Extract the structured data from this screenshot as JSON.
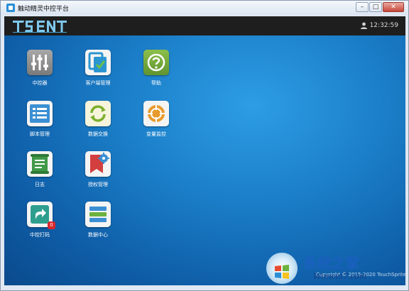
{
  "window": {
    "title": "触动精灵中控平台"
  },
  "header": {
    "logo_text": "TS ENT",
    "clock": "12:32:59"
  },
  "tiles": [
    {
      "label": "中控器",
      "icon": "sliders-icon",
      "color": "#8e8e8e"
    },
    {
      "label": "客户端管理",
      "icon": "client-check-icon",
      "color": "#2b95d0"
    },
    {
      "label": "帮助",
      "icon": "help-icon",
      "color": "#6aa13a"
    },
    {
      "label": "脚本管理",
      "icon": "list-icon",
      "color": "#3b8fd2"
    },
    {
      "label": "数据交换",
      "icon": "refresh-icon",
      "color": "#7cb02e"
    },
    {
      "label": "变量监控",
      "icon": "crosshair-icon",
      "color": "#e79b2e"
    },
    {
      "label": "日志",
      "icon": "scroll-icon",
      "color": "#3f9a48"
    },
    {
      "label": "授权管理",
      "icon": "bookmark-gear-icon",
      "color": "#d33f3f"
    },
    {
      "label": "中控打码",
      "icon": "share-icon",
      "color": "#2e9f8f",
      "badge": "0"
    },
    {
      "label": "数据中心",
      "icon": "stack-icon",
      "color": "#3b8fd2"
    }
  ],
  "footer": {
    "copyright": "Copyright © 2015-2020 TouchSprite"
  },
  "watermark": {
    "title": "系统之家",
    "url": "Winwin7.com"
  }
}
